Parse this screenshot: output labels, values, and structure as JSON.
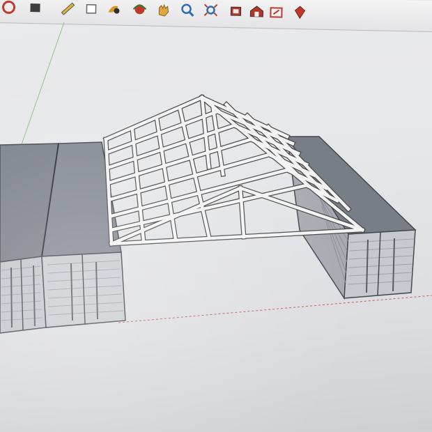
{
  "app": {
    "toolbar": {
      "tools": [
        {
          "name": "paint-bucket-icon",
          "color": "#c0392b"
        },
        {
          "name": "eraser-icon",
          "color": "#444444"
        },
        {
          "name": "pencil-icon",
          "color": "#e2b23a"
        },
        {
          "name": "select-icon",
          "color": "#777777"
        },
        {
          "name": "paint-icon",
          "color": "#d9952a"
        },
        {
          "name": "orbit-icon",
          "color": "#c0392b"
        },
        {
          "name": "pan-hand-icon",
          "color": "#e0a640"
        },
        {
          "name": "zoom-icon",
          "color": "#2d6db5"
        },
        {
          "name": "zoom-extents-icon",
          "color": "#2d6db5"
        },
        {
          "name": "component-icon",
          "color": "#b83227"
        },
        {
          "name": "warehouse-icon",
          "color": "#b83227"
        },
        {
          "name": "share-model-icon",
          "color": "#c0392b"
        },
        {
          "name": "ruby-icon",
          "color": "#c0392b"
        }
      ]
    },
    "viewport": {
      "background": "#e6e7e9",
      "model": {
        "container_color": "#c4c6cb",
        "container_roof_color": "#7e828b",
        "truss_color": "#f2f2f2",
        "truss_edge_color": "#4a4a4a"
      }
    }
  }
}
